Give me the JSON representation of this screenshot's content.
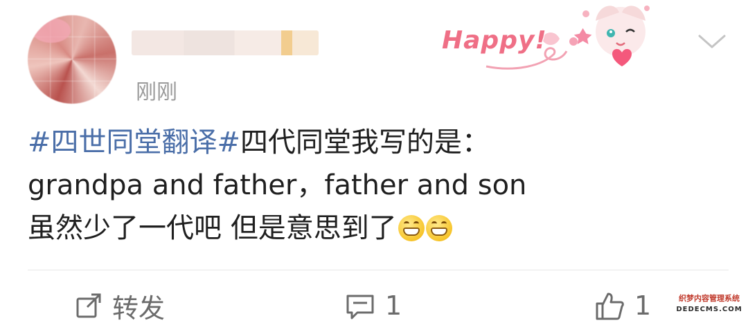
{
  "header": {
    "time": "刚刚"
  },
  "sticker": {
    "text": "Happy!"
  },
  "post": {
    "line1_hashtag": "#四世同堂翻译#",
    "line1_rest": "四代同堂我写的是：",
    "line2": "grandpa and father，father and son",
    "line3": "虽然少了一代吧 但是意思到了"
  },
  "actions": {
    "repost_label": "转发",
    "comment_count": "1",
    "like_count": "1"
  },
  "watermark": {
    "line1": "织梦内容管理系统",
    "line2": "DEDECMS.COM"
  },
  "colors": {
    "hashtag": "#4a6ea8",
    "text": "#1f1f1f",
    "muted": "#9a9a9a",
    "sticker_pink": "#ef6f86"
  },
  "icons": [
    "chevron-down-icon",
    "repost-icon",
    "comment-icon",
    "like-icon",
    "grin-emoji-icon"
  ]
}
